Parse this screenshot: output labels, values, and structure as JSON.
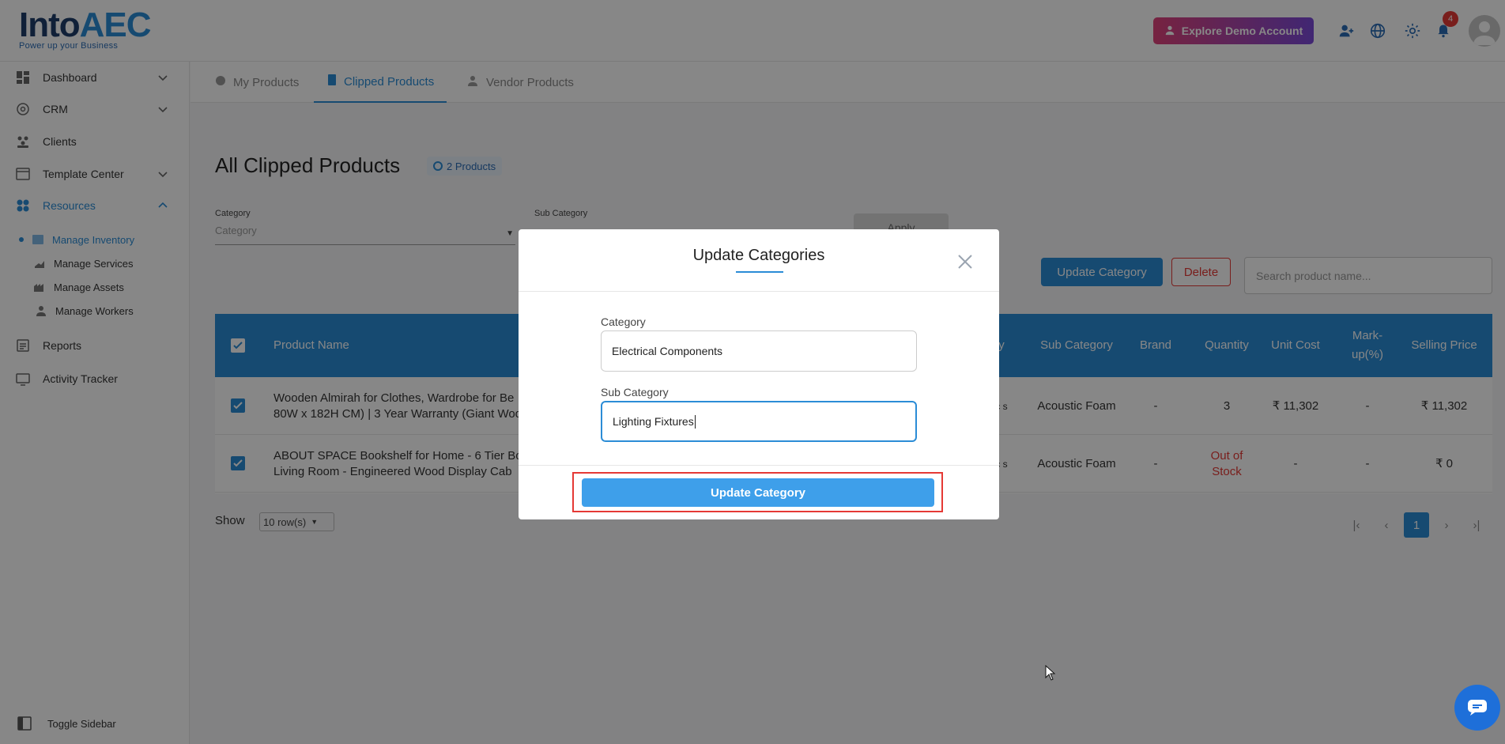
{
  "brand": {
    "logo_main": "Into",
    "logo_accent": "AEC",
    "tagline": "Power up your Business"
  },
  "topbar": {
    "demo_label": "Explore Demo Account",
    "notification_count": "4"
  },
  "sidebar": {
    "items": [
      {
        "label": "Dashboard"
      },
      {
        "label": "CRM"
      },
      {
        "label": "Clients"
      },
      {
        "label": "Template Center"
      },
      {
        "label": "Resources"
      },
      {
        "label": "Reports"
      },
      {
        "label": "Activity Tracker"
      }
    ],
    "sub_items": [
      {
        "label": "Manage Inventory"
      },
      {
        "label": "Manage Services"
      },
      {
        "label": "Manage Assets"
      },
      {
        "label": "Manage Workers"
      }
    ],
    "toggle_label": "Toggle Sidebar"
  },
  "tabs": [
    {
      "label": "My Products"
    },
    {
      "label": "Clipped Products"
    },
    {
      "label": "Vendor Products"
    }
  ],
  "page": {
    "title": "All Clipped Products",
    "count_badge": "2 Products",
    "filter_category_label": "Category",
    "filter_category_placeholder": "Category",
    "filter_subcategory_label": "Sub Category",
    "apply_label": "Apply",
    "update_category_label": "Update Category",
    "delete_label": "Delete",
    "search_placeholder": "Search product name..."
  },
  "table": {
    "headers": {
      "product_name": "Product Name",
      "category_tail": "y",
      "sub_category": "Sub Category",
      "brand": "Brand",
      "quantity": "Quantity",
      "unit_cost": "Unit Cost",
      "markup": "Mark-up(%)",
      "selling_price": "Selling Price"
    },
    "rows": [
      {
        "name_line1": "Wooden Almirah for Clothes, Wardrobe for Be",
        "name_line2": "80W x 182H CM) | 3 Year Warranty (Giant Woo",
        "category_tail": "c s",
        "sub_category": "Acoustic Foam",
        "brand": "-",
        "quantity": "3",
        "unit_cost": "₹ 11,302",
        "markup": "-",
        "selling_price": "₹ 11,302"
      },
      {
        "name_line1": "ABOUT SPACE Bookshelf for Home - 6 Tier Boo",
        "name_line2": "Living Room - Engineered Wood Display Cab",
        "category_tail": "c s",
        "sub_category": "Acoustic Foam",
        "brand": "-",
        "quantity": "Out of Stock",
        "unit_cost": "-",
        "markup": "-",
        "selling_price": "₹ 0"
      }
    ]
  },
  "pagination": {
    "show_label": "Show",
    "rows_value": "10 row(s)",
    "current_page": "1"
  },
  "modal": {
    "title": "Update Categories",
    "category_label": "Category",
    "category_value": "Electrical Components",
    "subcategory_label": "Sub Category",
    "subcategory_value": "Lighting Fixtures",
    "submit_label": "Update Category"
  },
  "colors": {
    "primary": "#2b8cd6",
    "danger": "#e53935",
    "demo_gradient_start": "#e0427a",
    "demo_gradient_end": "#7b4ad9"
  }
}
